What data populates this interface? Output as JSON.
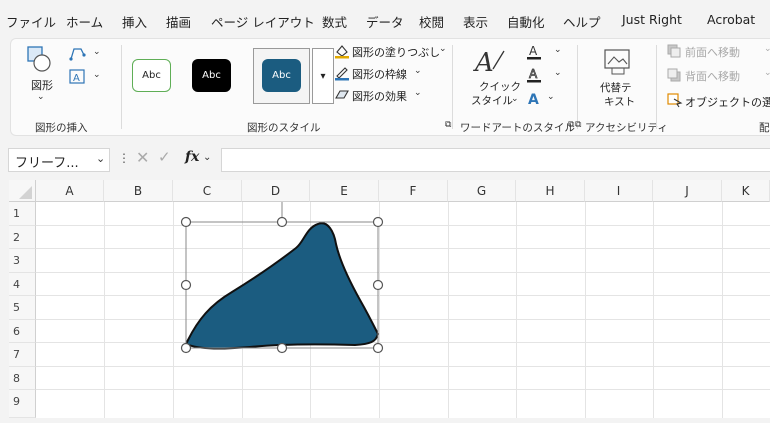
{
  "menu": {
    "tabs": [
      "ファイル",
      "ホーム",
      "挿入",
      "描画",
      "ページ レイアウト",
      "数式",
      "データ",
      "校閲",
      "表示",
      "自動化",
      "ヘルプ",
      "Just Right",
      "Acrobat"
    ]
  },
  "ribbon": {
    "insert_group": {
      "shape_label": "図形",
      "group_label": "図形の挿入"
    },
    "style_group": {
      "swatch_text": "Abc",
      "fill_label": "図形の塗りつぶし",
      "outline_label": "図形の枠線",
      "effects_label": "図形の効果",
      "group_label": "図形のスタイル"
    },
    "wordart_group": {
      "quick_style_line1": "クイック",
      "quick_style_line2": "スタイル",
      "group_label": "ワードアートのスタイル"
    },
    "accessibility_group": {
      "alt_text_line1": "代替テ",
      "alt_text_line2": "キスト",
      "group_label": "アクセシビリティ"
    },
    "arrange_group": {
      "bring_forward": "前面へ移動",
      "send_backward": "背面へ移動",
      "selection_pane": "オブジェクトの選択",
      "group_label": "配置"
    }
  },
  "formula_bar": {
    "name_box": "フリーフ...",
    "fx_label": "fx",
    "value": ""
  },
  "sheet": {
    "columns": [
      "A",
      "B",
      "C",
      "D",
      "E",
      "F",
      "G",
      "H",
      "I",
      "J",
      "K"
    ],
    "rows": [
      "1",
      "2",
      "3",
      "4",
      "5",
      "6",
      "7",
      "8",
      "9"
    ]
  },
  "shape": {
    "fill_color": "#1b5c80",
    "outline_color": "#111111"
  },
  "colors": {
    "swatch_green_border": "#5fae56",
    "swatch_black": "#000000",
    "swatch_blue": "#1b5c80",
    "fill_icon_accent": "#e0a800",
    "outline_icon_accent": "#2e75b6"
  }
}
